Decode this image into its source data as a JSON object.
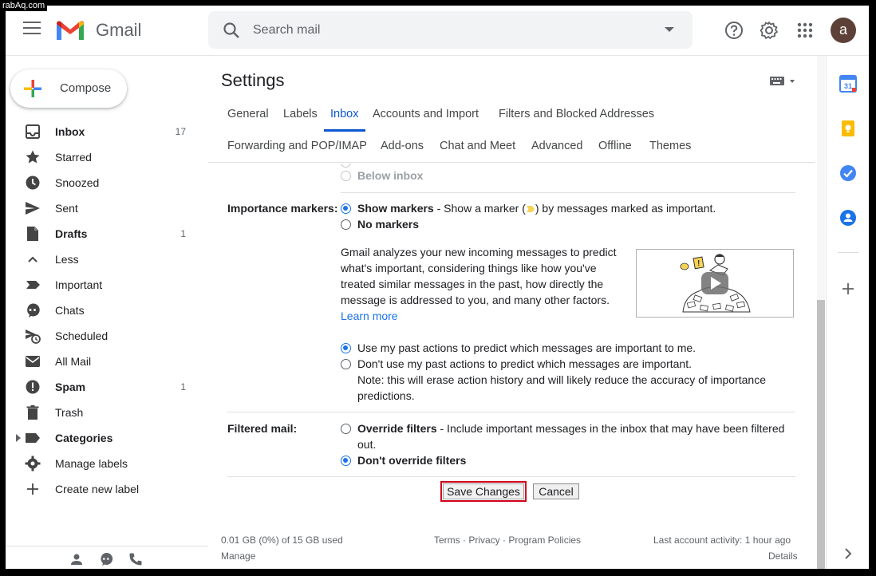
{
  "watermark": "rabAq.com",
  "header": {
    "app_name": "Gmail",
    "search_placeholder": "Search mail",
    "avatar_letter": "a",
    "icons": [
      "menu-icon",
      "help-icon",
      "gear-icon",
      "apps-grid-icon"
    ]
  },
  "sidebar": {
    "compose_label": "Compose",
    "items": [
      {
        "label": "Inbox",
        "count": "17",
        "bold": true,
        "icon": "inbox-icon"
      },
      {
        "label": "Starred",
        "count": "",
        "bold": false,
        "icon": "star-icon"
      },
      {
        "label": "Snoozed",
        "count": "",
        "bold": false,
        "icon": "clock-icon"
      },
      {
        "label": "Sent",
        "count": "",
        "bold": false,
        "icon": "send-icon"
      },
      {
        "label": "Drafts",
        "count": "1",
        "bold": true,
        "icon": "draft-icon"
      },
      {
        "label": "Less",
        "count": "",
        "bold": false,
        "icon": "chevron-up-icon"
      },
      {
        "label": "Important",
        "count": "",
        "bold": false,
        "icon": "important-icon"
      },
      {
        "label": "Chats",
        "count": "",
        "bold": false,
        "icon": "chat-icon"
      },
      {
        "label": "Scheduled",
        "count": "",
        "bold": false,
        "icon": "scheduled-icon"
      },
      {
        "label": "All Mail",
        "count": "",
        "bold": false,
        "icon": "mail-icon"
      },
      {
        "label": "Spam",
        "count": "1",
        "bold": true,
        "icon": "spam-icon"
      },
      {
        "label": "Trash",
        "count": "",
        "bold": false,
        "icon": "trash-icon"
      },
      {
        "label": "Categories",
        "count": "",
        "bold": true,
        "icon": "label-icon"
      },
      {
        "label": "Manage labels",
        "count": "",
        "bold": false,
        "icon": "gear-icon"
      },
      {
        "label": "Create new label",
        "count": "",
        "bold": false,
        "icon": "plus-icon"
      }
    ]
  },
  "settings": {
    "title": "Settings",
    "tabs_row1": [
      "General",
      "Labels",
      "Inbox",
      "Accounts and Import",
      "Filters and Blocked Addresses"
    ],
    "tabs_row2": [
      "Forwarding and POP/IMAP",
      "Add-ons",
      "Chat and Meet",
      "Advanced",
      "Offline",
      "Themes"
    ],
    "active_tab": "Inbox",
    "below_inbox": "Below inbox",
    "importance": {
      "label": "Importance markers:",
      "show_markers_bold": "Show markers",
      "show_markers_desc_a": " - Show a marker (",
      "show_markers_desc_b": ") by messages marked as important.",
      "no_markers": "No markers",
      "paragraph": "Gmail analyzes your new incoming messages to predict what's important, considering things like how you've treated similar messages in the past, how directly the message is addressed to you, and many other factors.",
      "learn_more": "Learn more",
      "use_past": "Use my past actions to predict which messages are important to me.",
      "dont_use_past": "Don't use my past actions to predict which messages are important.",
      "note_line1": "Note: this will erase action history and will likely reduce the accuracy of importance",
      "note_line2": "predictions."
    },
    "filtered": {
      "label": "Filtered mail:",
      "override_bold": "Override filters",
      "override_desc": " - Include important messages in the inbox that may have been filtered",
      "override_desc2": "out.",
      "dont_override": "Don't override filters"
    },
    "save_label": "Save Changes",
    "cancel_label": "Cancel"
  },
  "footer": {
    "storage": "0.01 GB (0%) of 15 GB used",
    "manage": "Manage",
    "links": "Terms · Privacy · Program Policies",
    "last_activity": "Last account activity: 1 hour ago",
    "details": "Details"
  },
  "side_panel": {
    "calendar_day": "31"
  },
  "colors": {
    "accent_blue": "#1a73e8",
    "save_highlight": "#d0021b",
    "avatar_bg": "#5d4037"
  }
}
